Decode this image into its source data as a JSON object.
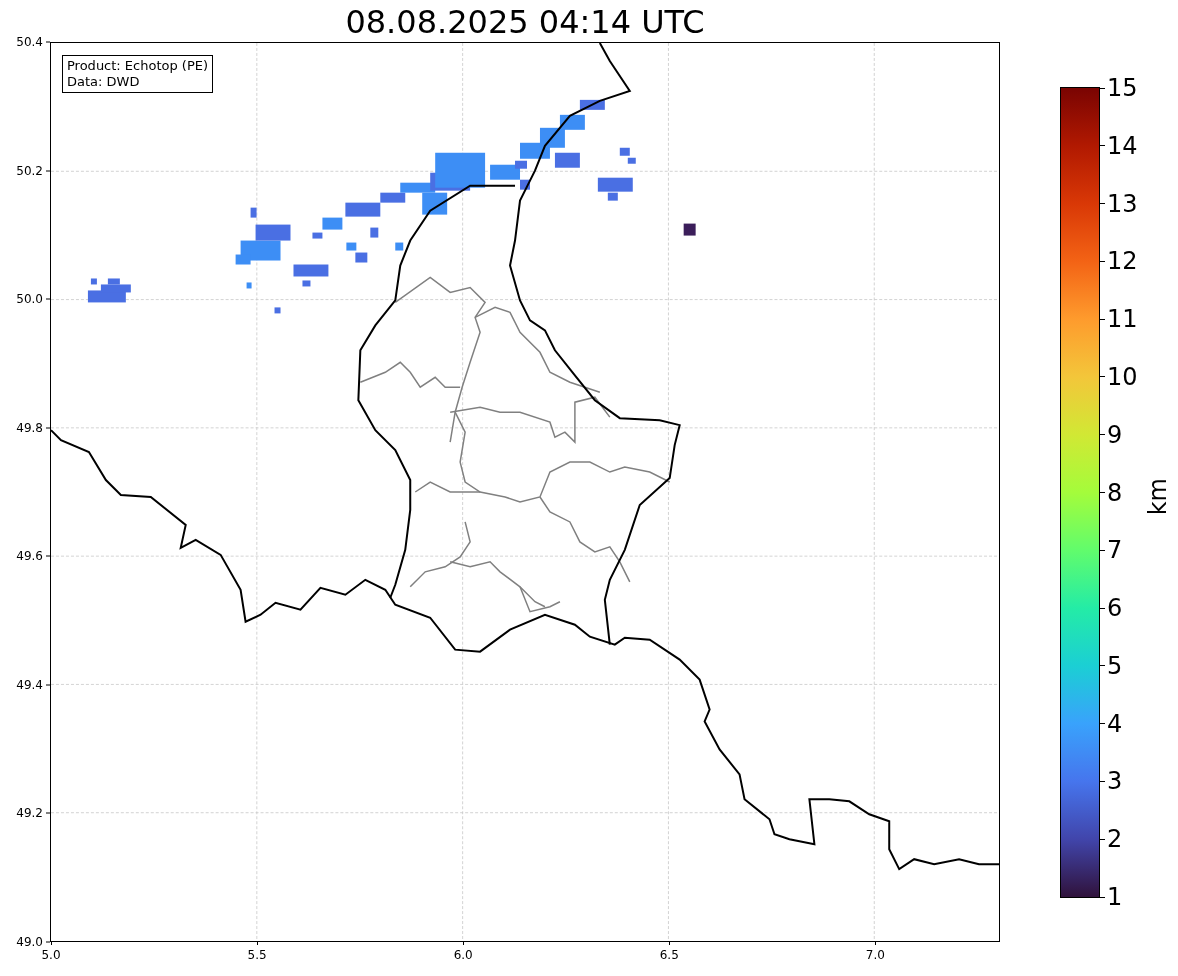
{
  "title": "08.08.2025 04:14 UTC",
  "map": {
    "legend": [
      "Product: Echotop (PE)",
      "Data: DWD"
    ],
    "xticks": [
      "5.0",
      "5.5",
      "6.0",
      "6.5",
      "7.0"
    ],
    "yticks": [
      "50.4",
      "50.2",
      "50.0",
      "49.8",
      "49.6",
      "49.4",
      "49.2",
      "49.0"
    ]
  },
  "colorbar": {
    "label": "km",
    "ticks": [
      "15",
      "14",
      "13",
      "12",
      "11",
      "10",
      "9",
      "8",
      "7",
      "6",
      "5",
      "4",
      "3",
      "2",
      "1"
    ]
  }
}
